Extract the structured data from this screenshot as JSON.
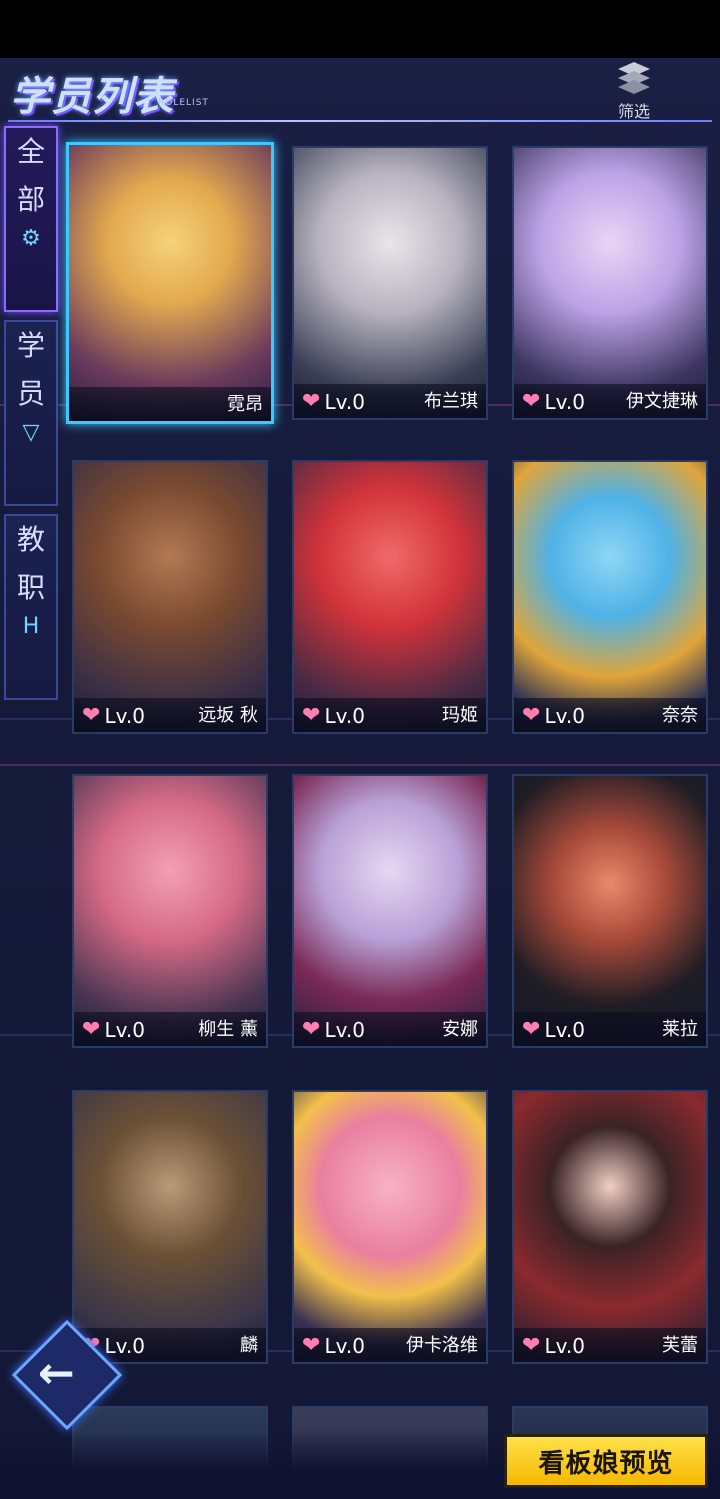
{
  "header": {
    "title": "学员列表",
    "subtitle": "ROLELIST",
    "filter_label": "筛选"
  },
  "tabs": [
    {
      "chars": [
        "全",
        "部"
      ],
      "icon": "⚙",
      "active": true
    },
    {
      "chars": [
        "学",
        "员"
      ],
      "icon": "▽",
      "active": false
    },
    {
      "chars": [
        "教",
        "职"
      ],
      "icon": "H",
      "active": false
    }
  ],
  "cards": [
    {
      "name": "霓昂",
      "lv": "",
      "selected": true
    },
    {
      "name": "布兰琪",
      "lv": "Lv.0",
      "selected": false
    },
    {
      "name": "伊文捷琳",
      "lv": "Lv.0",
      "selected": false
    },
    {
      "name": "远坂 秋",
      "lv": "Lv.0",
      "selected": false
    },
    {
      "name": "玛姬",
      "lv": "Lv.0",
      "selected": false
    },
    {
      "name": "奈奈",
      "lv": "Lv.0",
      "selected": false
    },
    {
      "name": "柳生 薰",
      "lv": "Lv.0",
      "selected": false
    },
    {
      "name": "安娜",
      "lv": "Lv.0",
      "selected": false
    },
    {
      "name": "莱拉",
      "lv": "Lv.0",
      "selected": false
    },
    {
      "name": "麟",
      "lv": "Lv.0",
      "selected": false
    },
    {
      "name": "伊卡洛维",
      "lv": "Lv.0",
      "selected": false
    },
    {
      "name": "芙蕾",
      "lv": "Lv.0",
      "selected": false
    }
  ],
  "buttons": {
    "back_icon": "←",
    "preview_label": "看板娘预览"
  },
  "colors": {
    "accent_blue": "#3ec8ff",
    "heart_pink": "#ff7fb2",
    "preview_yellow": "#ffd21f"
  }
}
